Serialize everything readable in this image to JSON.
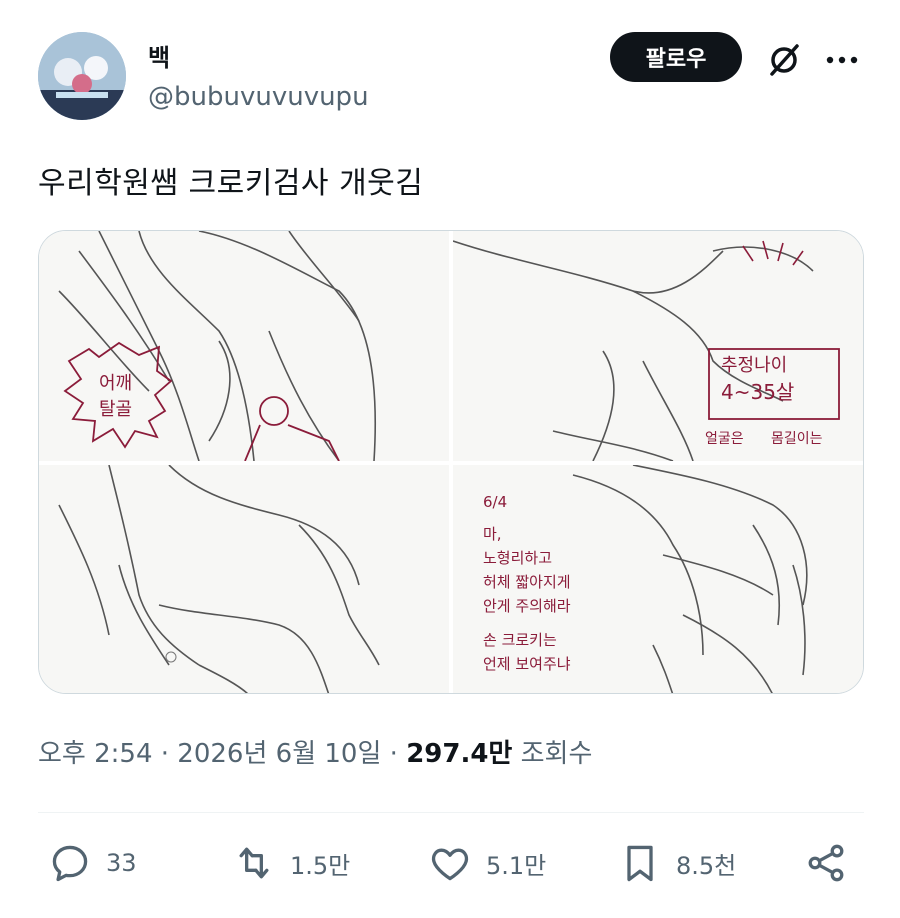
{
  "author": {
    "display_name": "백",
    "handle": "@bubuvuvuvupu"
  },
  "follow_label": "팔로우",
  "icons": {
    "grok": "grok-icon",
    "more": "more-icon",
    "reply": "reply-icon",
    "retweet": "retweet-icon",
    "like": "like-icon",
    "bookmark": "bookmark-icon",
    "share": "share-icon"
  },
  "tweet": {
    "text": "우리학원쌤 크로키검사 개웃김"
  },
  "media_annotations": {
    "panel1": [
      "어깨",
      "탈골"
    ],
    "panel2": [
      "추정나이",
      "4~35살",
      "얼굴은",
      "몸길이는"
    ],
    "panel4": [
      "6/4",
      "마,",
      "노형리하고",
      "허체 짧아지게",
      "안게 주의해라",
      "손 크로키는",
      "언제 보여주냐"
    ]
  },
  "meta": {
    "time": "오후 2:54",
    "date": "2026년 6월 10일",
    "separator": "·",
    "views_count": "297.4만",
    "views_label": "조회수"
  },
  "actions": {
    "replies": "33",
    "retweets": "1.5만",
    "likes": "5.1만",
    "bookmarks": "8.5천"
  },
  "colors": {
    "follow_bg": "#0f1419",
    "secondary_text": "#536471",
    "annotation_ink": "#8b1c3a"
  }
}
